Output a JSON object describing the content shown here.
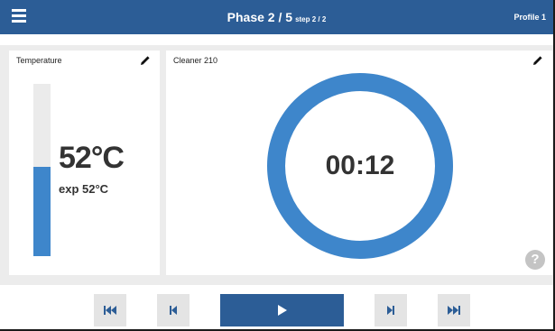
{
  "header": {
    "phase_label": "Phase 2 / 5",
    "step_label": "step 2 / 2",
    "profile_label": "Profile 1"
  },
  "temperature": {
    "title": "Temperature",
    "value": "52°C",
    "expected": "exp 52°C",
    "level_fraction": 0.52
  },
  "timer": {
    "title": "Cleaner 210",
    "time": "00:12",
    "progress_fraction": 1.0,
    "help_label": "?"
  },
  "controls": {
    "icons": [
      "skip-to-start-icon",
      "step-back-icon",
      "play-icon",
      "step-forward-icon",
      "skip-to-end-icon"
    ]
  },
  "colors": {
    "header": "#2c5d96",
    "accent": "#3e86cb",
    "background": "#ececec",
    "button": "#e4e4e4"
  }
}
